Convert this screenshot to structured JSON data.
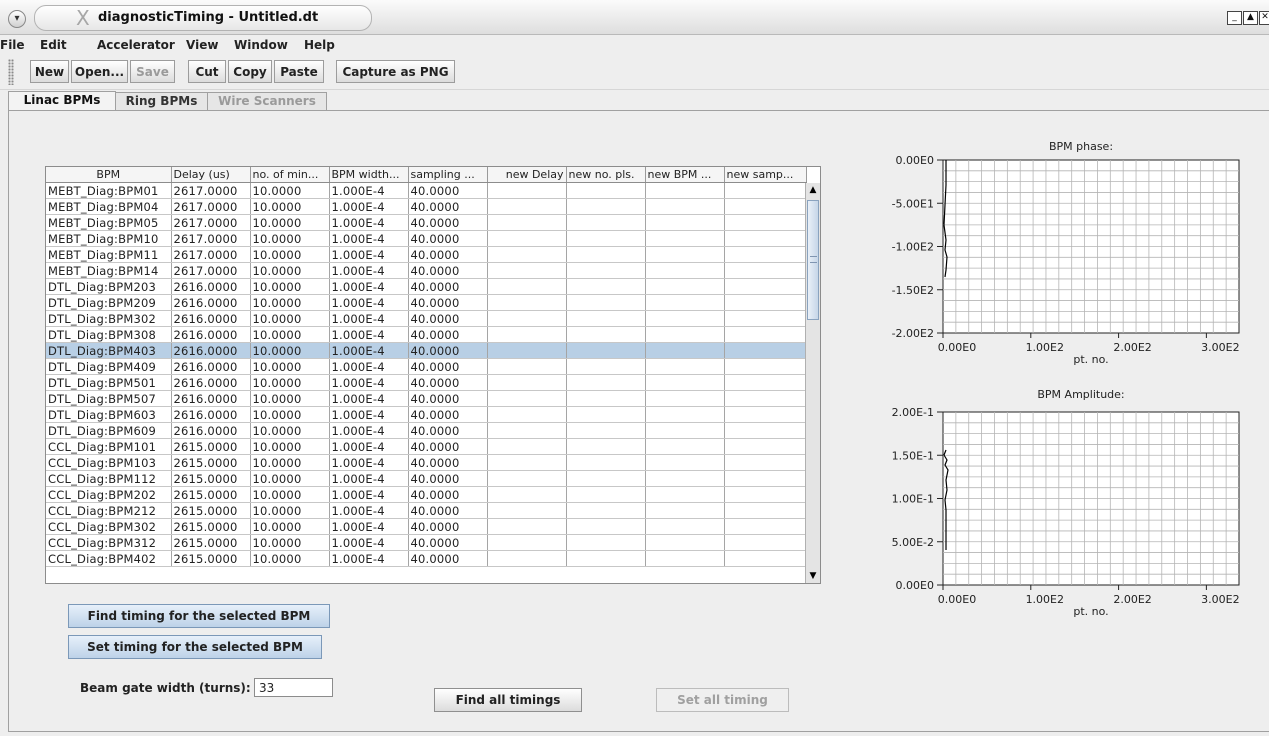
{
  "window": {
    "title": "diagnosticTiming - Untitled.dt"
  },
  "menubar": [
    "File",
    "Edit",
    "Accelerator",
    "View",
    "Window",
    "Help"
  ],
  "toolbar": {
    "new": "New",
    "open": "Open...",
    "save": "Save",
    "cut": "Cut",
    "copy": "Copy",
    "paste": "Paste",
    "capture": "Capture as PNG"
  },
  "tabs": [
    "Linac BPMs",
    "Ring BPMs",
    "Wire Scanners"
  ],
  "table": {
    "columns": [
      "BPM",
      "Delay (us)",
      "no. of min...",
      "BPM width...",
      "sampling ...",
      "new Delay",
      "new no. pls.",
      "new BPM ...",
      "new samp..."
    ],
    "rows": [
      [
        "MEBT_Diag:BPM01",
        "2617.0000",
        "10.0000",
        "1.000E-4",
        "40.0000"
      ],
      [
        "MEBT_Diag:BPM04",
        "2617.0000",
        "10.0000",
        "1.000E-4",
        "40.0000"
      ],
      [
        "MEBT_Diag:BPM05",
        "2617.0000",
        "10.0000",
        "1.000E-4",
        "40.0000"
      ],
      [
        "MEBT_Diag:BPM10",
        "2617.0000",
        "10.0000",
        "1.000E-4",
        "40.0000"
      ],
      [
        "MEBT_Diag:BPM11",
        "2617.0000",
        "10.0000",
        "1.000E-4",
        "40.0000"
      ],
      [
        "MEBT_Diag:BPM14",
        "2617.0000",
        "10.0000",
        "1.000E-4",
        "40.0000"
      ],
      [
        "DTL_Diag:BPM203",
        "2616.0000",
        "10.0000",
        "1.000E-4",
        "40.0000"
      ],
      [
        "DTL_Diag:BPM209",
        "2616.0000",
        "10.0000",
        "1.000E-4",
        "40.0000"
      ],
      [
        "DTL_Diag:BPM302",
        "2616.0000",
        "10.0000",
        "1.000E-4",
        "40.0000"
      ],
      [
        "DTL_Diag:BPM308",
        "2616.0000",
        "10.0000",
        "1.000E-4",
        "40.0000"
      ],
      [
        "DTL_Diag:BPM403",
        "2616.0000",
        "10.0000",
        "1.000E-4",
        "40.0000"
      ],
      [
        "DTL_Diag:BPM409",
        "2616.0000",
        "10.0000",
        "1.000E-4",
        "40.0000"
      ],
      [
        "DTL_Diag:BPM501",
        "2616.0000",
        "10.0000",
        "1.000E-4",
        "40.0000"
      ],
      [
        "DTL_Diag:BPM507",
        "2616.0000",
        "10.0000",
        "1.000E-4",
        "40.0000"
      ],
      [
        "DTL_Diag:BPM603",
        "2616.0000",
        "10.0000",
        "1.000E-4",
        "40.0000"
      ],
      [
        "DTL_Diag:BPM609",
        "2616.0000",
        "10.0000",
        "1.000E-4",
        "40.0000"
      ],
      [
        "CCL_Diag:BPM101",
        "2615.0000",
        "10.0000",
        "1.000E-4",
        "40.0000"
      ],
      [
        "CCL_Diag:BPM103",
        "2615.0000",
        "10.0000",
        "1.000E-4",
        "40.0000"
      ],
      [
        "CCL_Diag:BPM112",
        "2615.0000",
        "10.0000",
        "1.000E-4",
        "40.0000"
      ],
      [
        "CCL_Diag:BPM202",
        "2615.0000",
        "10.0000",
        "1.000E-4",
        "40.0000"
      ],
      [
        "CCL_Diag:BPM212",
        "2615.0000",
        "10.0000",
        "1.000E-4",
        "40.0000"
      ],
      [
        "CCL_Diag:BPM302",
        "2615.0000",
        "10.0000",
        "1.000E-4",
        "40.0000"
      ],
      [
        "CCL_Diag:BPM312",
        "2615.0000",
        "10.0000",
        "1.000E-4",
        "40.0000"
      ],
      [
        "CCL_Diag:BPM402",
        "2615.0000",
        "10.0000",
        "1.000E-4",
        "40.0000"
      ]
    ],
    "selected_row": 10
  },
  "buttons": {
    "find_selected": "Find timing for the selected BPM",
    "set_selected": "Set timing for the selected BPM",
    "find_all": "Find all timings",
    "set_all": "Set all timing"
  },
  "beam_gate": {
    "label": "Beam gate width (turns):",
    "value": "33"
  },
  "charts": [
    {
      "title": "BPM phase:",
      "xlabel": "pt. no.",
      "y_ticks": [
        "0.00E0",
        "-5.00E1",
        "-1.00E2",
        "-1.50E2",
        "-2.00E2"
      ],
      "x_ticks": [
        "0.00E0",
        "1.00E2",
        "2.00E2",
        "3.00E2"
      ]
    },
    {
      "title": "BPM Amplitude:",
      "xlabel": "pt. no.",
      "y_ticks": [
        "2.00E-1",
        "1.50E-1",
        "1.00E-1",
        "5.00E-2",
        "0.00E0"
      ],
      "x_ticks": [
        "0.00E0",
        "1.00E2",
        "2.00E2",
        "3.00E2"
      ]
    }
  ],
  "colors": {
    "selection": "#b8cfe5",
    "grid": "#b5b5b5"
  }
}
